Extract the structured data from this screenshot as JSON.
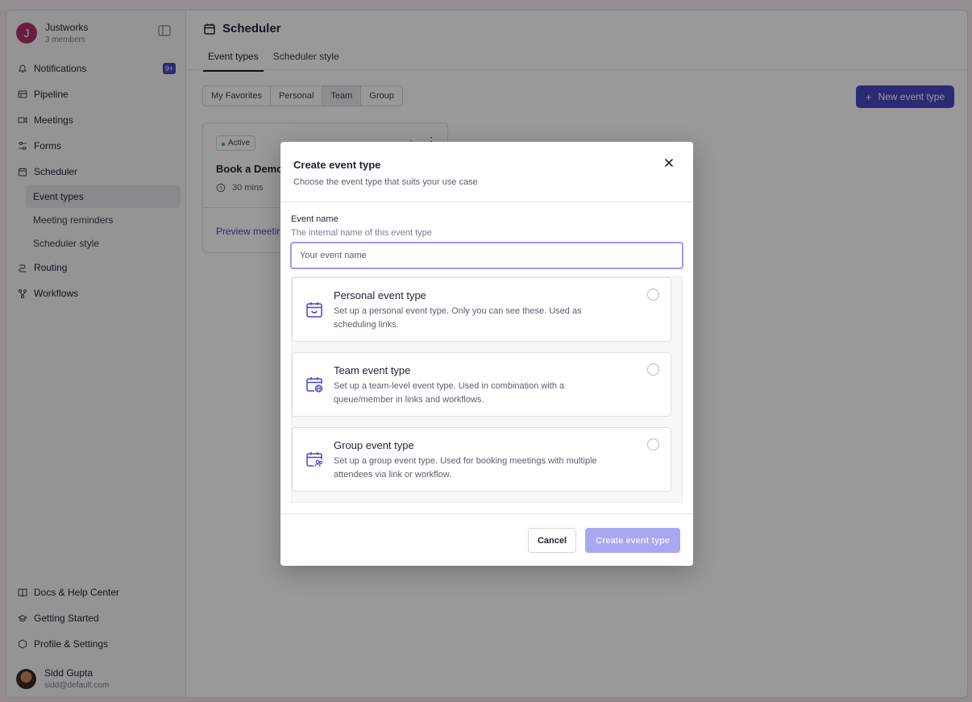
{
  "workspace": {
    "initial": "J",
    "name": "Justworks",
    "members": "3 members"
  },
  "sidebar": {
    "items": [
      {
        "label": "Notifications",
        "icon": "bell-icon",
        "badge": "9+"
      },
      {
        "label": "Pipeline",
        "icon": "pipeline-icon"
      },
      {
        "label": "Meetings",
        "icon": "video-icon"
      },
      {
        "label": "Forms",
        "icon": "forms-icon"
      },
      {
        "label": "Scheduler",
        "icon": "calendar-icon"
      }
    ],
    "scheduler_sub": [
      {
        "label": "Event types",
        "active": true
      },
      {
        "label": "Meeting reminders"
      },
      {
        "label": "Scheduler style"
      }
    ],
    "items_after": [
      {
        "label": "Routing",
        "icon": "routing-icon"
      },
      {
        "label": "Workflows",
        "icon": "workflow-icon"
      }
    ],
    "bottom": [
      {
        "label": "Docs & Help Center",
        "icon": "book-icon"
      },
      {
        "label": "Getting Started",
        "icon": "graduation-icon"
      },
      {
        "label": "Profile & Settings",
        "icon": "hexagon-icon"
      }
    ],
    "user": {
      "name": "Sidd Gupta",
      "email": "sidd@default.com"
    }
  },
  "header": {
    "title": "Scheduler",
    "tabs": [
      "Event types",
      "Scheduler style"
    ],
    "active_tab": "Event types"
  },
  "filters": {
    "options": [
      "My Favorites",
      "Personal",
      "Team",
      "Group"
    ],
    "selected": "Team"
  },
  "new_button": "New event type",
  "event_card": {
    "status": "Active",
    "title": "Book a Demo",
    "duration": "30 mins",
    "link": "Preview meeting"
  },
  "modal": {
    "title": "Create event type",
    "subtitle": "Choose the event type that suits your use case",
    "field_label": "Event name",
    "field_help": "The internal name of this event type",
    "field_placeholder": "Your event name",
    "field_value": "",
    "options": [
      {
        "title": "Personal event type",
        "desc": "Set up a personal event type. Only you can see these. Used as scheduling links.",
        "icon": "calendar-smile-icon",
        "selected": false
      },
      {
        "title": "Team event type",
        "desc": "Set up a team-level event type. Used in combination with a queue/member in links and workflows.",
        "icon": "calendar-globe-icon",
        "selected": false
      },
      {
        "title": "Group event type",
        "desc": "Set up a group event type. Used for booking meetings with multiple attendees via link or workflow.",
        "icon": "calendar-group-icon",
        "selected": false
      }
    ],
    "cancel": "Cancel",
    "create": "Create event type"
  },
  "colors": {
    "accent": "#4a47c4",
    "accent_disabled": "#a9a7ef",
    "workspace_avatar": "#b0336a"
  }
}
